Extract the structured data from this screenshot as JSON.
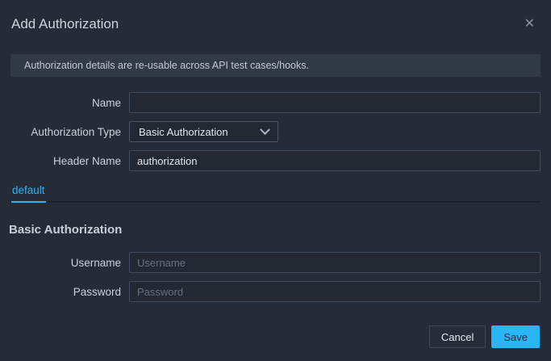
{
  "modal": {
    "title": "Add Authorization"
  },
  "icons": {
    "close_icon": "✕",
    "chevron_down_icon": "v-shape"
  },
  "banner": {
    "text": "Authorization details are re-usable across API test cases/hooks."
  },
  "form": {
    "name": {
      "label": "Name",
      "value": "",
      "placeholder": ""
    },
    "auth_type": {
      "label": "Authorization Type",
      "selected": "Basic Authorization"
    },
    "header_name": {
      "label": "Header Name",
      "value": "authorization"
    }
  },
  "tabs": [
    {
      "label": "default",
      "active": true
    }
  ],
  "section": {
    "heading": "Basic Authorization"
  },
  "credentials": {
    "username": {
      "label": "Username",
      "placeholder": "Username",
      "value": ""
    },
    "password": {
      "label": "Password",
      "placeholder": "Password",
      "value": ""
    }
  },
  "footer": {
    "cancel_label": "Cancel",
    "save_label": "Save"
  },
  "colors": {
    "accent": "#29b6f6",
    "modal_bg": "#252b37",
    "banner_bg": "#333a47",
    "input_border": "#3f4b5e",
    "save_text": "#1e2c3a"
  }
}
